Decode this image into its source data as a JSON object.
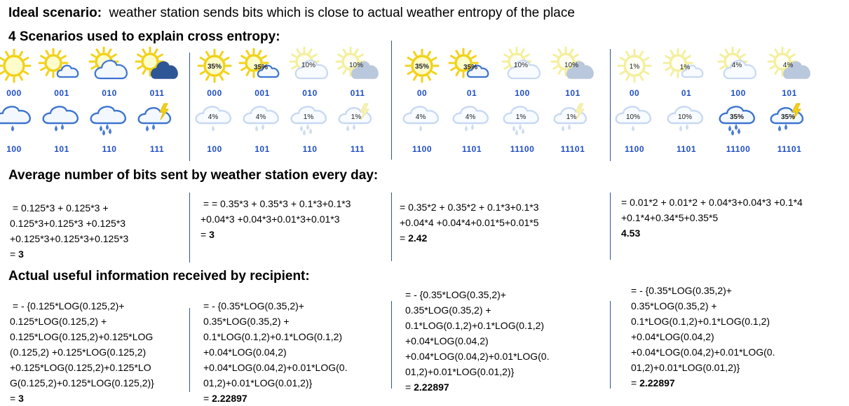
{
  "intro": {
    "label": "Ideal scenario:",
    "text": "weather station sends bits which is close to actual weather entropy of the place"
  },
  "scenarios_heading": "4 Scenarios used to explain cross entropy:",
  "bits_heading": "Average number of bits sent by weather station every day:",
  "info_heading": "Actual useful information received by recipient:",
  "weather_types": [
    "sunny",
    "sun-cloud",
    "sun-big-cloud",
    "sun-dark-cloud",
    "cloud-drop",
    "cloud-rain",
    "cloud-heavy-rain",
    "thunderstorm"
  ],
  "scenarios": [
    {
      "codes": [
        "000",
        "001",
        "010",
        "011",
        "100",
        "101",
        "110",
        "111"
      ],
      "percents": [
        "",
        "",
        "",
        "",
        "",
        "",
        "",
        ""
      ],
      "faded": [
        false,
        false,
        false,
        false,
        false,
        false,
        false,
        false
      ],
      "bits_lines": [
        " = 0.125*3 + 0.125*3 +",
        "0.125*3+0.125*3 +0.125*3",
        "+0.125*3+0.125*3+0.125*3",
        "= "
      ],
      "bits_result": "3",
      "info_lines": [
        " = - {0.125*LOG(0.125,2)+",
        "0.125*LOG(0.125,2) +",
        "0.125*LOG(0.125,2)+0.125*LOG",
        "(0.125,2) +0.125*LOG(0.125,2)",
        "+0.125*LOG(0.125,2)+0.125*LO",
        "G(0.125,2)+0.125*LOG(0.125,2)}",
        "= "
      ],
      "info_result": "3"
    },
    {
      "codes": [
        "000",
        "001",
        "010",
        "011",
        "100",
        "101",
        "110",
        "111"
      ],
      "percents": [
        "35%",
        "35%",
        "10%",
        "10%",
        "4%",
        "4%",
        "1%",
        "1%"
      ],
      "faded": [
        false,
        false,
        true,
        true,
        true,
        true,
        true,
        true
      ],
      "bits_lines": [
        " = = 0.35*3 + 0.35*3 + 0.1*3+0.1*3",
        "+0.04*3 +0.04*3+0.01*3+0.01*3",
        "= "
      ],
      "bits_result": "3",
      "info_lines": [
        "= - {0.35*LOG(0.35,2)+",
        "0.35*LOG(0.35,2) +",
        "0.1*LOG(0.1,2)+0.1*LOG(0.1,2)",
        "+0.04*LOG(0.04,2)",
        "+0.04*LOG(0.04,2)+0.01*LOG(0.",
        "01,2)+0.01*LOG(0.01,2)}",
        "= "
      ],
      "info_result": "2.22897"
    },
    {
      "codes": [
        "00",
        "01",
        "100",
        "101",
        "1100",
        "1101",
        "11100",
        "11101"
      ],
      "percents": [
        "35%",
        "35%",
        "10%",
        "10%",
        "4%",
        "4%",
        "1%",
        "1%"
      ],
      "faded": [
        false,
        false,
        true,
        true,
        true,
        true,
        true,
        true
      ],
      "bits_lines": [
        "= 0.35*2 + 0.35*2 + 0.1*3+0.1*3",
        "+0.04*4 +0.04*4+0.01*5+0.01*5",
        "= "
      ],
      "bits_result": "2.42",
      "info_lines": [
        "= - {0.35*LOG(0.35,2)+",
        "0.35*LOG(0.35,2) +",
        "0.1*LOG(0.1,2)+0.1*LOG(0.1,2)",
        "+0.04*LOG(0.04,2)",
        "+0.04*LOG(0.04,2)+0.01*LOG(0.",
        "01,2)+0.01*LOG(0.01,2)}",
        "= "
      ],
      "info_result": "2.22897"
    },
    {
      "codes": [
        "00",
        "01",
        "100",
        "101",
        "1100",
        "1101",
        "11100",
        "11101"
      ],
      "percents": [
        "1%",
        "1%",
        "4%",
        "4%",
        "10%",
        "10%",
        "35%",
        "35%"
      ],
      "faded": [
        true,
        true,
        true,
        true,
        true,
        true,
        false,
        false
      ],
      "bits_lines": [
        "= 0.01*2 + 0.01*2 + 0.04*3+0.04*3 +0.1*4",
        "+0.1*4+0.34*5+0.35*5",
        ""
      ],
      "bits_result": "4.53",
      "info_lines": [
        "= - {0.35*LOG(0.35,2)+",
        "0.35*LOG(0.35,2) +",
        "0.1*LOG(0.1,2)+0.1*LOG(0.1,2)",
        "+0.04*LOG(0.04,2)",
        "+0.04*LOG(0.04,2)+0.01*LOG(0.",
        "01,2)+0.01*LOG(0.01,2)}",
        "= "
      ],
      "info_result": "2.22897"
    }
  ]
}
